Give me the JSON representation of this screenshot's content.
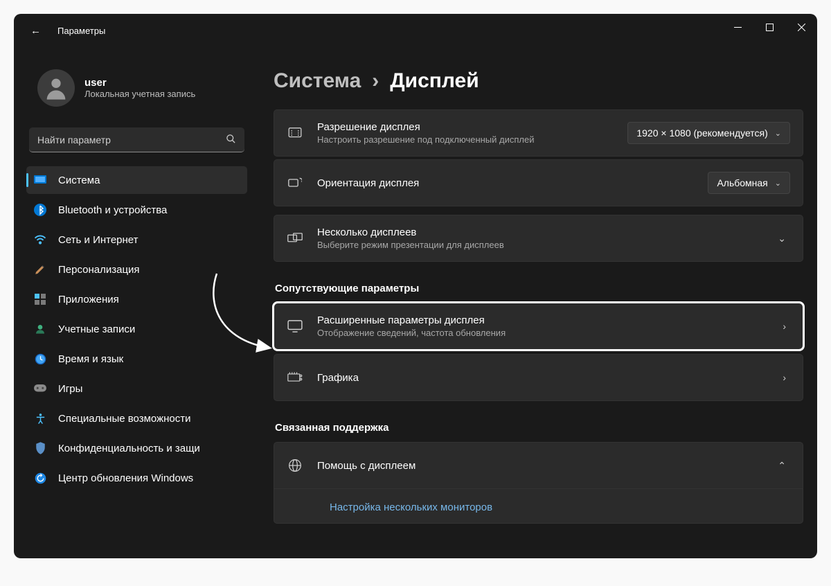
{
  "app_title": "Параметры",
  "user": {
    "name": "user",
    "sub": "Локальная учетная запись"
  },
  "search": {
    "placeholder": "Найти параметр"
  },
  "nav": {
    "system": "Система",
    "bluetooth": "Bluetooth и устройства",
    "network": "Сеть и Интернет",
    "personalization": "Персонализация",
    "apps": "Приложения",
    "accounts": "Учетные записи",
    "time": "Время и язык",
    "gaming": "Игры",
    "accessibility": "Специальные возможности",
    "privacy": "Конфиденциальность и защи",
    "update": "Центр обновления Windows"
  },
  "breadcrumb": {
    "prev": "Система",
    "sep": "›",
    "curr": "Дисплей"
  },
  "cards": {
    "resolution": {
      "title": "Разрешение дисплея",
      "sub": "Настроить разрешение под подключенный дисплей",
      "value": "1920 × 1080 (рекомендуется)"
    },
    "orientation": {
      "title": "Ориентация дисплея",
      "value": "Альбомная"
    },
    "multi": {
      "title": "Несколько дисплеев",
      "sub": "Выберите режим презентации для дисплеев"
    }
  },
  "section_related": "Сопутствующие параметры",
  "advanced": {
    "title": "Расширенные параметры дисплея",
    "sub": "Отображение сведений, частота обновления"
  },
  "graphics": {
    "title": "Графика"
  },
  "section_support": "Связанная поддержка",
  "help": {
    "title": "Помощь с дисплеем",
    "link": "Настройка нескольких мониторов"
  }
}
